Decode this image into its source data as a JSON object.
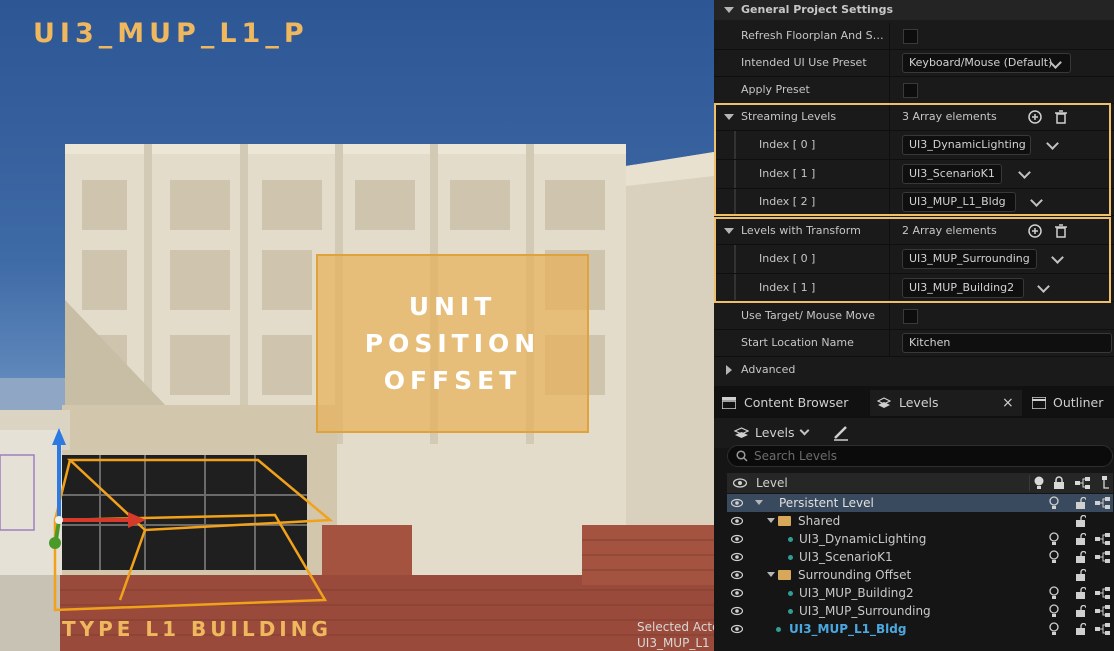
{
  "viewport": {
    "level_title": "UI3_MUP_L1_P",
    "offset_box_lines": [
      "UNIT",
      "POSITION",
      "OFFSET"
    ],
    "bottom_label": "TYPE L1 BUILDING",
    "selected_actor_line1": "Selected Acto",
    "selected_actor_line2": "UI3_MUP_L1"
  },
  "details": {
    "section_title": "General Project Settings",
    "refresh_floorplan_label": "Refresh Floorplan And Setti...",
    "intended_ui_label": "Intended UI Use Preset",
    "intended_ui_value": "Keyboard/Mouse (Default)",
    "apply_preset_label": "Apply Preset",
    "streaming_levels": {
      "label": "Streaming Levels",
      "count": "3 Array elements",
      "items": [
        {
          "index": "Index [ 0 ]",
          "value": "UI3_DynamicLighting"
        },
        {
          "index": "Index [ 1 ]",
          "value": "UI3_ScenarioK1"
        },
        {
          "index": "Index [ 2 ]",
          "value": "UI3_MUP_L1_Bldg"
        }
      ]
    },
    "levels_with_transform": {
      "label": "Levels with Transform",
      "count": "2 Array elements",
      "items": [
        {
          "index": "Index [ 0 ]",
          "value": "UI3_MUP_Surrounding"
        },
        {
          "index": "Index [ 1 ]",
          "value": "UI3_MUP_Building2"
        }
      ]
    },
    "use_target_label": "Use Target/ Mouse Move",
    "start_location_label": "Start Location Name",
    "start_location_value": "Kitchen",
    "advanced_label": "Advanced"
  },
  "levels_panel": {
    "tabs": [
      "Content Browser",
      "Levels",
      "Outliner"
    ],
    "toolbar_dropdown": "Levels",
    "search_placeholder": "Search Levels",
    "column_level": "Level",
    "rows": [
      {
        "name": "Persistent Level",
        "kind": "persistent"
      },
      {
        "name": "Shared",
        "kind": "folder"
      },
      {
        "name": "UI3_DynamicLighting",
        "kind": "level"
      },
      {
        "name": "UI3_ScenarioK1",
        "kind": "level"
      },
      {
        "name": "Surrounding Offset",
        "kind": "folder"
      },
      {
        "name": "UI3_MUP_Building2",
        "kind": "level"
      },
      {
        "name": "UI3_MUP_Surrounding",
        "kind": "level"
      },
      {
        "name": "UI3_MUP_L1_Bldg",
        "kind": "current"
      }
    ]
  },
  "colors": {
    "accent_highlight": "#efc06b",
    "level_dot": "#2f9f95",
    "current_level_text": "#4aa8e0",
    "selected_row_bg": "#3a4a5e"
  }
}
